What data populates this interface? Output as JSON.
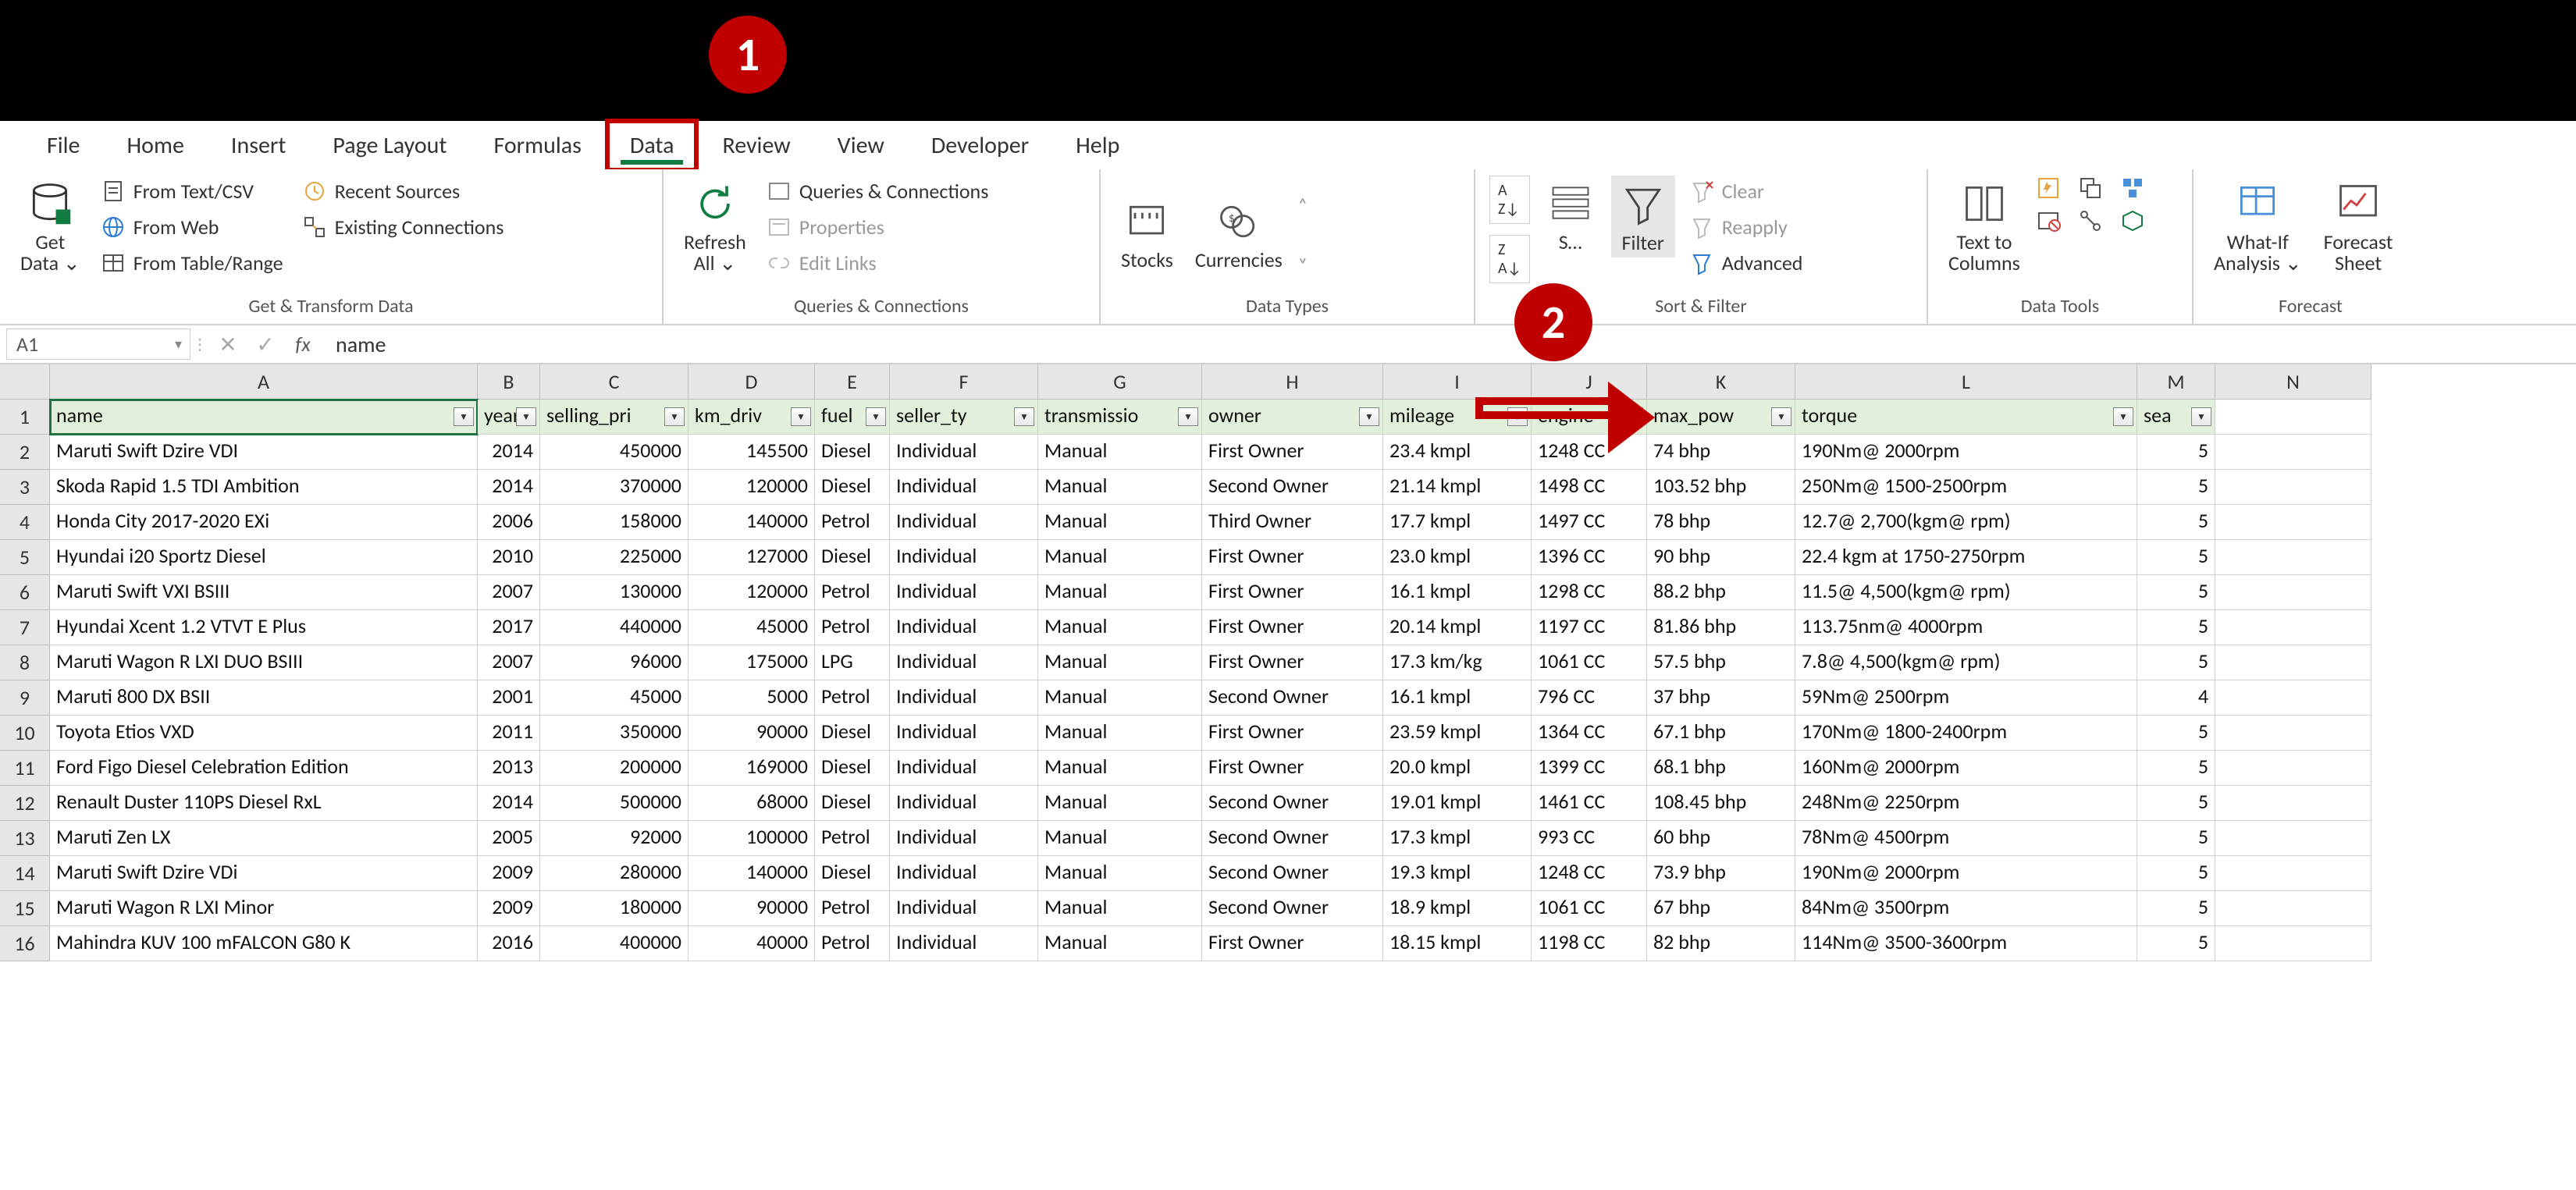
{
  "tabs": [
    "File",
    "Home",
    "Insert",
    "Page Layout",
    "Formulas",
    "Data",
    "Review",
    "View",
    "Developer",
    "Help"
  ],
  "activeTab": "Data",
  "callout1": "1",
  "callout2": "2",
  "ribbon": {
    "getData": {
      "label": "Get\nData ⌄",
      "group": "Get & Transform Data",
      "items": [
        "From Text/CSV",
        "From Web",
        "From Table/Range",
        "Recent Sources",
        "Existing Connections"
      ]
    },
    "queries": {
      "label": "Refresh\nAll ⌄",
      "group": "Queries & Connections",
      "items": [
        "Queries & Connections",
        "Properties",
        "Edit Links"
      ]
    },
    "dataTypes": {
      "stocks": "Stocks",
      "currencies": "Currencies",
      "group": "Data Types"
    },
    "sortFilter": {
      "sortAZ": "A→Z",
      "sortZA": "Z→A",
      "sort": "Sort",
      "filter": "Filter",
      "clear": "Clear",
      "reapply": "Reapply",
      "advanced": "Advanced",
      "group": "Sort & Filter"
    },
    "dataTools": {
      "textToColumns": "Text to\nColumns",
      "group": "Data Tools"
    },
    "forecast": {
      "whatIf": "What-If\nAnalysis ⌄",
      "forecast": "Forecast\nSheet",
      "group": "Forecast"
    }
  },
  "nameBox": "A1",
  "formula": "name",
  "columns": [
    "A",
    "B",
    "C",
    "D",
    "E",
    "F",
    "G",
    "H",
    "I",
    "J",
    "K",
    "L",
    "M",
    "N"
  ],
  "headers": [
    "name",
    "year",
    "selling_pri",
    "km_driv",
    "fuel",
    "seller_ty",
    "transmissio",
    "owner",
    "mileage",
    "engine",
    "max_pow",
    "torque",
    "sea"
  ],
  "rows": [
    {
      "n": 1
    },
    {
      "n": 2,
      "cells": [
        "Maruti Swift Dzire VDI",
        "2014",
        "450000",
        "145500",
        "Diesel",
        "Individual",
        "Manual",
        "First Owner",
        "23.4 kmpl",
        "1248 CC",
        "74 bhp",
        "190Nm@ 2000rpm",
        "5"
      ]
    },
    {
      "n": 3,
      "cells": [
        "Skoda Rapid 1.5 TDI Ambition",
        "2014",
        "370000",
        "120000",
        "Diesel",
        "Individual",
        "Manual",
        "Second Owner",
        "21.14 kmpl",
        "1498 CC",
        "103.52 bhp",
        "250Nm@ 1500-2500rpm",
        "5"
      ]
    },
    {
      "n": 4,
      "cells": [
        "Honda City 2017-2020 EXi",
        "2006",
        "158000",
        "140000",
        "Petrol",
        "Individual",
        "Manual",
        "Third Owner",
        "17.7 kmpl",
        "1497 CC",
        "78 bhp",
        "12.7@ 2,700(kgm@ rpm)",
        "5"
      ]
    },
    {
      "n": 5,
      "cells": [
        "Hyundai i20 Sportz Diesel",
        "2010",
        "225000",
        "127000",
        "Diesel",
        "Individual",
        "Manual",
        "First Owner",
        "23.0 kmpl",
        "1396 CC",
        "90 bhp",
        "22.4 kgm at 1750-2750rpm",
        "5"
      ]
    },
    {
      "n": 6,
      "cells": [
        "Maruti Swift VXI BSIII",
        "2007",
        "130000",
        "120000",
        "Petrol",
        "Individual",
        "Manual",
        "First Owner",
        "16.1 kmpl",
        "1298 CC",
        "88.2 bhp",
        "11.5@ 4,500(kgm@ rpm)",
        "5"
      ]
    },
    {
      "n": 7,
      "cells": [
        "Hyundai Xcent 1.2 VTVT E Plus",
        "2017",
        "440000",
        "45000",
        "Petrol",
        "Individual",
        "Manual",
        "First Owner",
        "20.14 kmpl",
        "1197 CC",
        "81.86 bhp",
        "113.75nm@ 4000rpm",
        "5"
      ]
    },
    {
      "n": 8,
      "cells": [
        "Maruti Wagon R LXI DUO BSIII",
        "2007",
        "96000",
        "175000",
        "LPG",
        "Individual",
        "Manual",
        "First Owner",
        "17.3 km/kg",
        "1061 CC",
        "57.5 bhp",
        "7.8@ 4,500(kgm@ rpm)",
        "5"
      ]
    },
    {
      "n": 9,
      "cells": [
        "Maruti 800 DX BSII",
        "2001",
        "45000",
        "5000",
        "Petrol",
        "Individual",
        "Manual",
        "Second Owner",
        "16.1 kmpl",
        "796 CC",
        "37 bhp",
        "59Nm@ 2500rpm",
        "4"
      ]
    },
    {
      "n": 10,
      "cells": [
        "Toyota Etios VXD",
        "2011",
        "350000",
        "90000",
        "Diesel",
        "Individual",
        "Manual",
        "First Owner",
        "23.59 kmpl",
        "1364 CC",
        "67.1 bhp",
        "170Nm@ 1800-2400rpm",
        "5"
      ]
    },
    {
      "n": 11,
      "cells": [
        "Ford Figo Diesel Celebration Edition",
        "2013",
        "200000",
        "169000",
        "Diesel",
        "Individual",
        "Manual",
        "First Owner",
        "20.0 kmpl",
        "1399 CC",
        "68.1 bhp",
        "160Nm@ 2000rpm",
        "5"
      ]
    },
    {
      "n": 12,
      "cells": [
        "Renault Duster 110PS Diesel RxL",
        "2014",
        "500000",
        "68000",
        "Diesel",
        "Individual",
        "Manual",
        "Second Owner",
        "19.01 kmpl",
        "1461 CC",
        "108.45 bhp",
        "248Nm@ 2250rpm",
        "5"
      ]
    },
    {
      "n": 13,
      "cells": [
        "Maruti Zen LX",
        "2005",
        "92000",
        "100000",
        "Petrol",
        "Individual",
        "Manual",
        "Second Owner",
        "17.3 kmpl",
        "993 CC",
        "60 bhp",
        "78Nm@ 4500rpm",
        "5"
      ]
    },
    {
      "n": 14,
      "cells": [
        "Maruti Swift Dzire VDi",
        "2009",
        "280000",
        "140000",
        "Diesel",
        "Individual",
        "Manual",
        "Second Owner",
        "19.3 kmpl",
        "1248 CC",
        "73.9 bhp",
        "190Nm@ 2000rpm",
        "5"
      ]
    },
    {
      "n": 15,
      "cells": [
        "Maruti Wagon R LXI Minor",
        "2009",
        "180000",
        "90000",
        "Petrol",
        "Individual",
        "Manual",
        "Second Owner",
        "18.9 kmpl",
        "1061 CC",
        "67 bhp",
        "84Nm@ 3500rpm",
        "5"
      ]
    },
    {
      "n": 16,
      "cells": [
        "Mahindra KUV 100 mFALCON G80 K",
        "2016",
        "400000",
        "40000",
        "Petrol",
        "Individual",
        "Manual",
        "First Owner",
        "18.15 kmpl",
        "1198 CC",
        "82 bhp",
        "114Nm@ 3500-3600rpm",
        "5"
      ]
    }
  ],
  "numericCols": [
    1,
    2,
    3,
    12
  ]
}
